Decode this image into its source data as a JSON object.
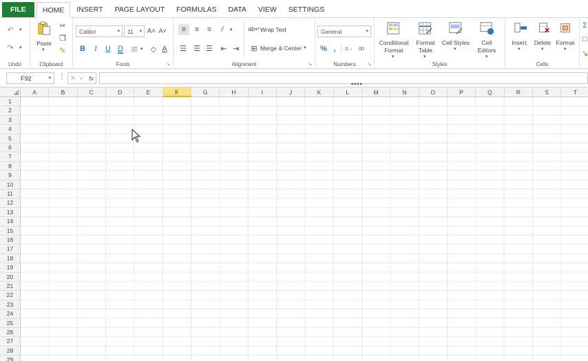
{
  "tabs": [
    {
      "label": "FILE"
    },
    {
      "label": "HOME"
    },
    {
      "label": "INSERT"
    },
    {
      "label": "PAGE LAYOUT"
    },
    {
      "label": "FORMULAS"
    },
    {
      "label": "DATA"
    },
    {
      "label": "VIEW"
    },
    {
      "label": "SETTINGS"
    }
  ],
  "ribbon": {
    "undo": {
      "label": "Undo"
    },
    "clipboard": {
      "label": "Clipboard",
      "paste": "Paste"
    },
    "fonts": {
      "label": "Fonts",
      "font_name": "Calibri",
      "font_size": "11"
    },
    "alignment": {
      "label": "Alignment",
      "wrap_text": "Wrap Text",
      "merge_center": "Merge & Center"
    },
    "numbers": {
      "label": "Numbers",
      "format": "General"
    },
    "styles": {
      "label": "Styles",
      "conditional_format": [
        "Conditional",
        "Format"
      ],
      "format_table": [
        "Format",
        "Table"
      ],
      "cell_styles": "Cell Styles",
      "cell_editors": [
        "Cell",
        "Editors"
      ]
    },
    "cells": {
      "label": "Cells",
      "insert": "Insert",
      "delete": "Delete",
      "format": "Format"
    }
  },
  "formula_bar": {
    "name_box": "F92",
    "fx": "fx",
    "formula": ""
  },
  "grid": {
    "columns": [
      "A",
      "B",
      "C",
      "D",
      "E",
      "F",
      "G",
      "H",
      "I",
      "J",
      "K",
      "L",
      "M",
      "N",
      "O",
      "P",
      "Q",
      "R",
      "S",
      "T"
    ],
    "selected_column": "F",
    "rows": [
      "1",
      "2",
      "3",
      "4",
      "5",
      "6",
      "7",
      "8",
      "9",
      "10",
      "11",
      "12",
      "13",
      "14",
      "15",
      "16",
      "17",
      "18",
      "19",
      "20",
      "21",
      "22",
      "23",
      "24",
      "25",
      "26",
      "27",
      "28",
      "29"
    ]
  },
  "colors": {
    "file_tab": "#1e7e34",
    "selected_header": "#fbe284",
    "accent_blue": "#2e75b6"
  }
}
